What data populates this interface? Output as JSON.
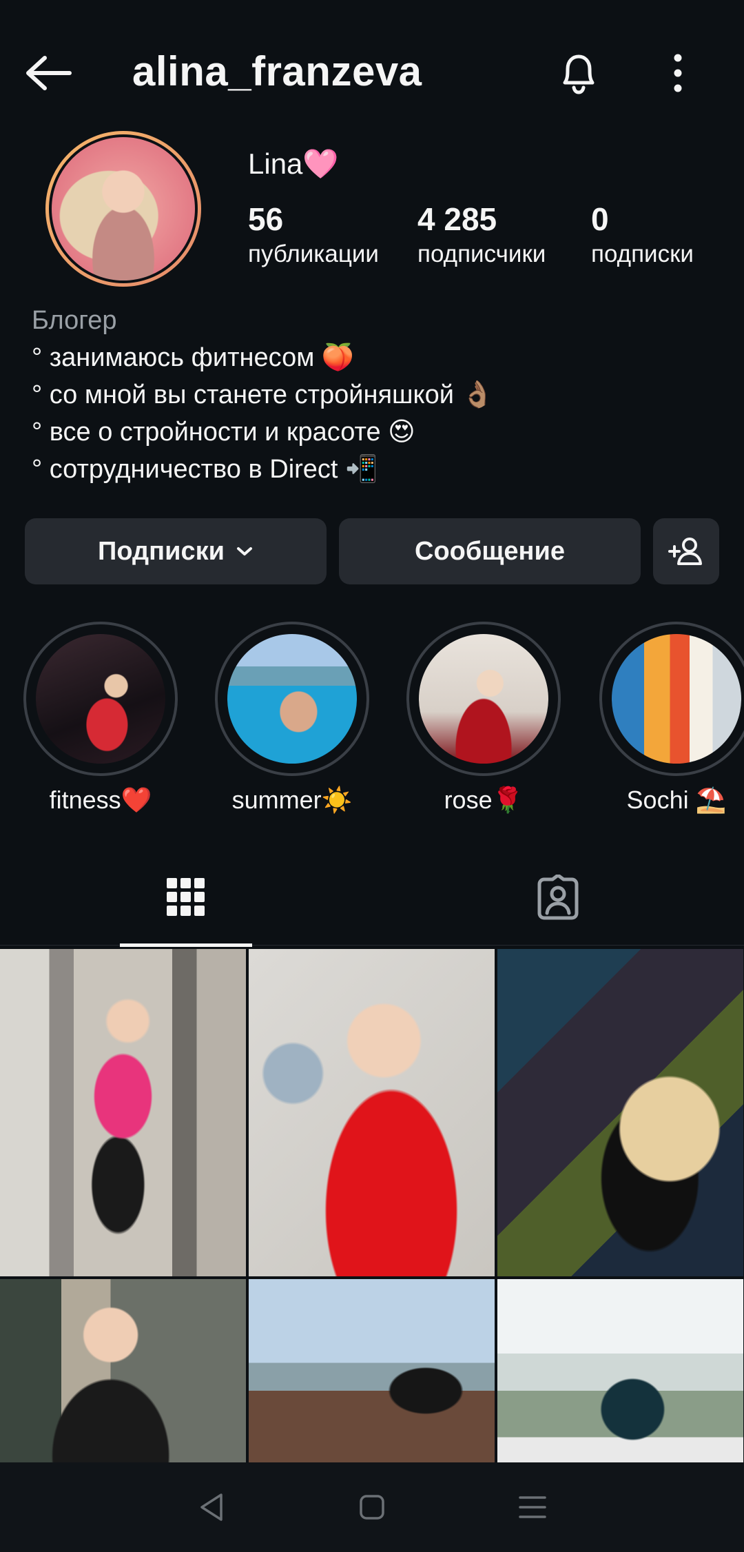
{
  "header": {
    "username": "alina_franzeva",
    "back_icon": "arrow-left-icon",
    "bell_icon": "bell-icon",
    "more_icon": "more-vertical-icon"
  },
  "profile": {
    "display_name": "Lina🩷",
    "stats": {
      "posts": {
        "count": "56",
        "label": "публикации"
      },
      "followers": {
        "count": "4 285",
        "label": "подписчики"
      },
      "following": {
        "count": "0",
        "label": "подписки"
      }
    },
    "category": "Блогер",
    "bio": [
      "° занимаюсь фитнесом 🍑",
      "° со мной вы станете стройняшкой 👌🏽",
      "° все о стройности и красоте 😍",
      "° сотрудничество в Direct 📲"
    ]
  },
  "actions": {
    "following_label": "Подписки",
    "message_label": "Сообщение",
    "add_user_icon": "person-add-icon"
  },
  "highlights": [
    {
      "label": "fitness❤️"
    },
    {
      "label": "summer☀️"
    },
    {
      "label": "rose🌹"
    },
    {
      "label": "Sochi ⛱️"
    }
  ],
  "tabs": {
    "grid_icon": "grid-icon",
    "tagged_icon": "tagged-user-icon",
    "active": "grid"
  },
  "colors": {
    "background": "#0c1014",
    "button": "#262a30",
    "text": "#f5f5f5",
    "muted": "#9aa0a6"
  }
}
